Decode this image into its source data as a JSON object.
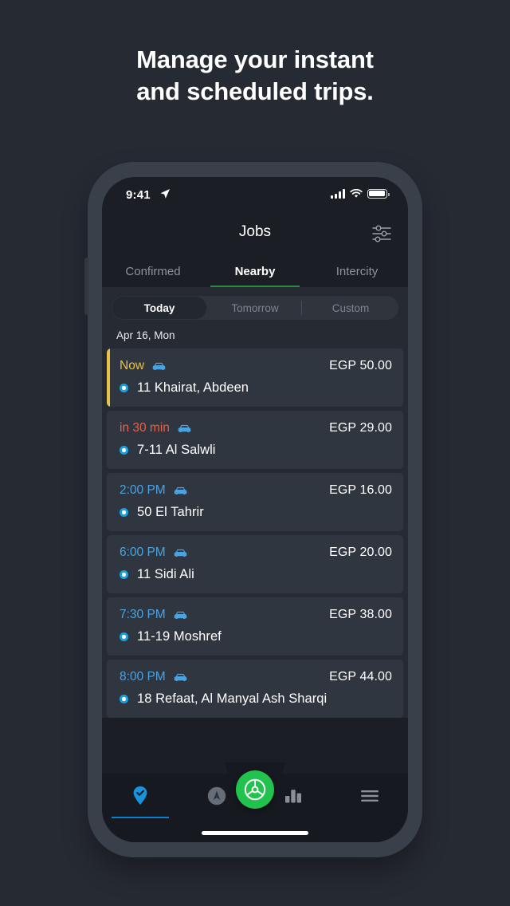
{
  "headline": {
    "line1": "Manage your instant",
    "line2": "and scheduled trips."
  },
  "status_bar": {
    "time": "9:41",
    "location_icon": "location-arrow-icon",
    "signal_icon": "cellular-signal-icon",
    "wifi_icon": "wifi-icon",
    "battery_icon": "battery-full-icon"
  },
  "header": {
    "title": "Jobs",
    "filter_icon": "sliders-filter-icon"
  },
  "tabs": [
    {
      "label": "Confirmed",
      "active": false
    },
    {
      "label": "Nearby",
      "active": true
    },
    {
      "label": "Intercity",
      "active": false
    }
  ],
  "segmented": [
    {
      "label": "Today",
      "active": true
    },
    {
      "label": "Tomorrow",
      "active": false
    },
    {
      "label": "Custom",
      "active": false
    }
  ],
  "date_header": "Apr 16, Mon",
  "jobs": [
    {
      "time": "Now",
      "time_style": "now",
      "accent": true,
      "vehicle_icon": "car-icon",
      "fare": "EGP 50.00",
      "pin_icon": "location-dot-icon",
      "address": "11 Khairat, Abdeen"
    },
    {
      "time": "in 30 min",
      "time_style": "soon",
      "accent": false,
      "vehicle_icon": "car-icon",
      "fare": "EGP 29.00",
      "pin_icon": "location-dot-icon",
      "address": "7-11 Al Salwli"
    },
    {
      "time": "2:00 PM",
      "time_style": "sched",
      "accent": false,
      "vehicle_icon": "car-icon",
      "fare": "EGP 16.00",
      "pin_icon": "location-dot-icon",
      "address": "50 El Tahrir"
    },
    {
      "time": "6:00 PM",
      "time_style": "sched",
      "accent": false,
      "vehicle_icon": "car-icon",
      "fare": "EGP 20.00",
      "pin_icon": "location-dot-icon",
      "address": "11 Sidi Ali"
    },
    {
      "time": "7:30 PM",
      "time_style": "sched",
      "accent": false,
      "vehicle_icon": "car-icon",
      "fare": "EGP 38.00",
      "pin_icon": "location-dot-icon",
      "address": "11-19 Moshref"
    },
    {
      "time": "8:00 PM",
      "time_style": "sched",
      "accent": false,
      "vehicle_icon": "car-icon",
      "fare": "EGP 44.00",
      "pin_icon": "location-dot-icon",
      "address": "18 Refaat, Al Manyal Ash Sharqi"
    }
  ],
  "bottom_nav": {
    "items": [
      {
        "icon": "pin-check-icon",
        "active": true
      },
      {
        "icon": "navigation-arrow-circle-icon",
        "active": false
      },
      {
        "icon": "bar-chart-icon",
        "active": false
      },
      {
        "icon": "hamburger-menu-icon",
        "active": false
      }
    ],
    "fab_icon": "steering-wheel-icon"
  },
  "colors": {
    "page_background": "#262a33",
    "screen_background": "#1b1e24",
    "card_background": "#303640",
    "accent_yellow": "#e6c34a",
    "accent_red": "#e8604c",
    "accent_blue": "#4aa3e0",
    "tab_indicator_green": "#2a8a3e",
    "fab_green": "#22c24f",
    "nav_active_blue": "#0f7fd4"
  }
}
